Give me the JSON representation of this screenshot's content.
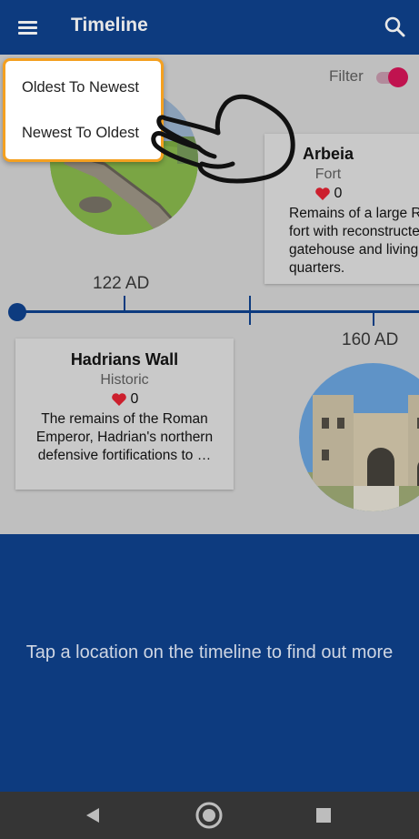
{
  "appbar": {
    "title": "Timeline",
    "menu_icon": "hamburger-menu-icon",
    "search_icon": "search-icon"
  },
  "filter": {
    "label": "Filter",
    "enabled": true,
    "color": "#c0134f"
  },
  "sort_menu": {
    "items": [
      "Oldest To Newest",
      "Newest To Oldest"
    ],
    "highlight_color": "#f4a020"
  },
  "timeline": {
    "years": [
      "122 AD",
      "160 AD"
    ],
    "items": [
      {
        "title": "Hadrians Wall",
        "type": "Historic",
        "likes": "0",
        "description": "The remains of the Roman Emperor, Hadrian's northern defensive fortifications to …"
      },
      {
        "title": "Arbeia",
        "type": "Fort",
        "likes": "0",
        "description": "Remains of a large Roman fort with reconstructed gatehouse and living quarters."
      }
    ]
  },
  "bottom": {
    "instruction": "Tap a location on the timeline to find out more"
  },
  "navbar": {
    "back_icon": "back-triangle-icon",
    "home_icon": "home-circle-icon",
    "recents_icon": "recents-square-icon"
  },
  "colors": {
    "primary": "#0d3b7f",
    "content_bg": "#bfbfbf",
    "heart": "#cc1f2d"
  }
}
